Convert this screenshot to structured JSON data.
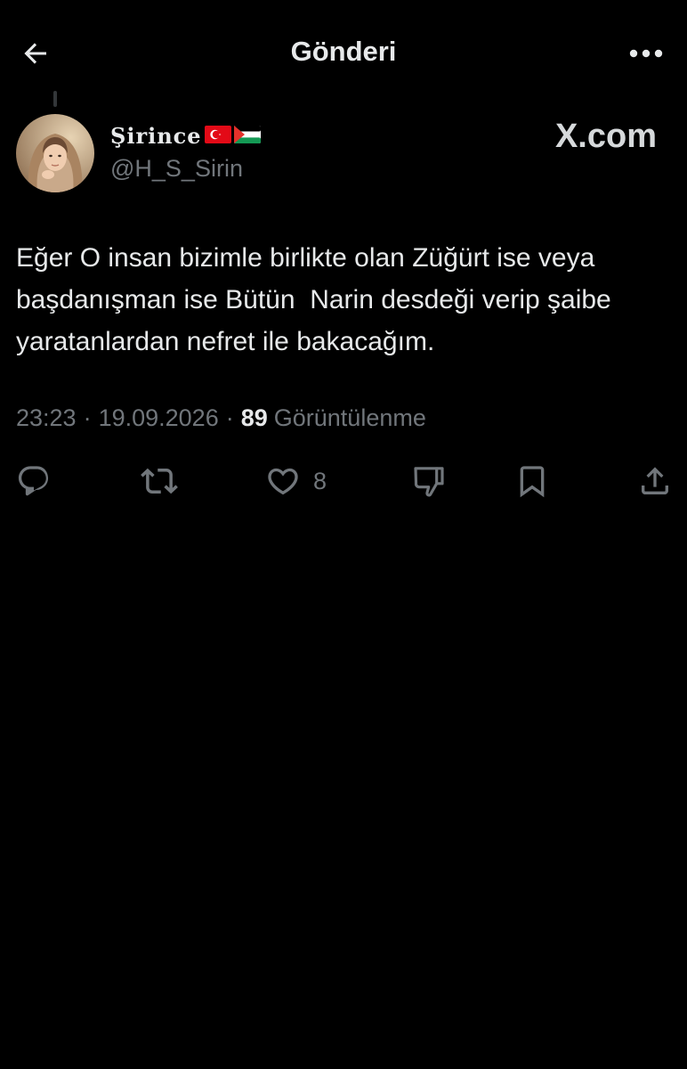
{
  "header": {
    "title": "Gönderi",
    "back_icon": "arrow-left-icon",
    "more_icon": "more-horizontal-icon"
  },
  "post": {
    "author_name": "Şirince",
    "author_flags": [
      "🇹🇷",
      "🇵🇸"
    ],
    "author_handle": "@H_S_Sirin",
    "text": "Eğer O insan bizimle birlikte olan Züğürt ise veya başdanışman ise Bütün  Narin desdeği verip şaibe yaratanlardan nefret ile bakacağım.",
    "time": "23:23",
    "date": "19.09.2026",
    "separator": "·",
    "views_count": "89",
    "views_label": "Görüntülenme"
  },
  "watermark": {
    "text": "X.com"
  },
  "actions": {
    "reply": {
      "icon": "reply-icon",
      "count": ""
    },
    "repost": {
      "icon": "repost-icon",
      "count": ""
    },
    "like": {
      "icon": "heart-icon",
      "count": "8"
    },
    "dislike": {
      "icon": "thumbs-down-icon",
      "count": ""
    },
    "bookmark": {
      "icon": "bookmark-icon",
      "count": ""
    },
    "share": {
      "icon": "share-icon",
      "count": ""
    }
  },
  "colors": {
    "background": "#000000",
    "primary_text": "#e7e9ea",
    "secondary_text": "#71767b"
  }
}
